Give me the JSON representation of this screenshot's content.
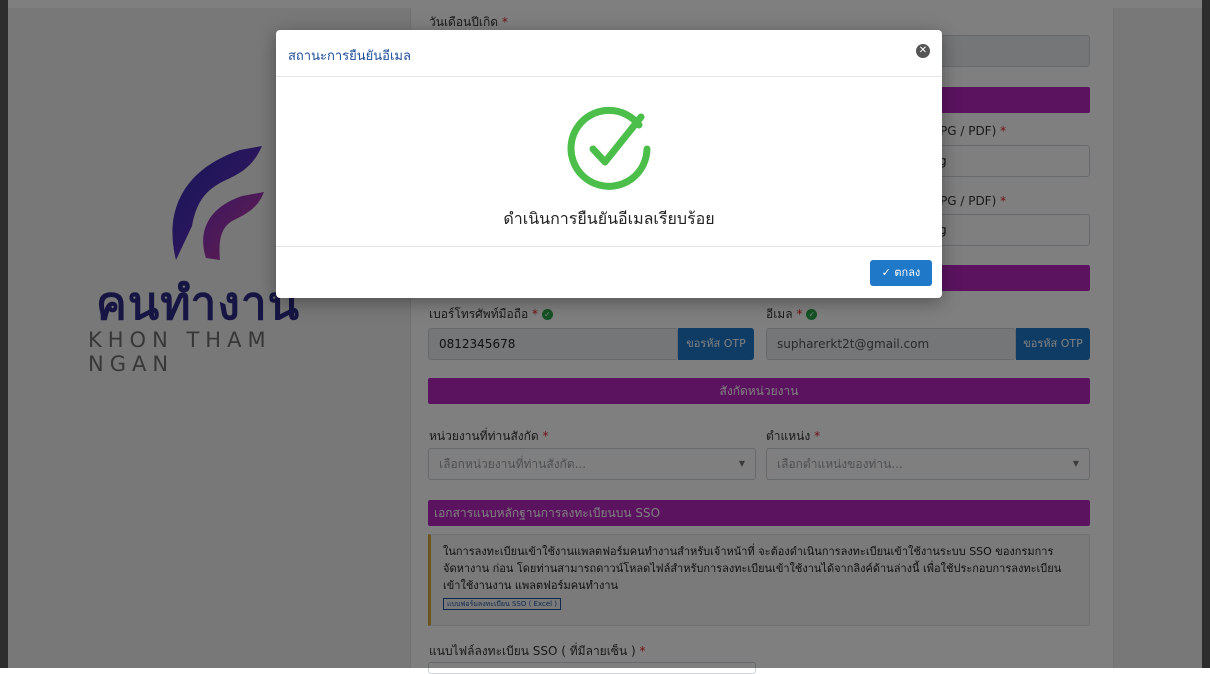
{
  "logo": {
    "thai": "คนทำงาน",
    "english": "KHON THAM NGAN"
  },
  "form": {
    "dob_label": "วันเดือนปีเกิด",
    "required_mark": "*",
    "file1_label": "PG / PDF)",
    "file1_value": "g",
    "file2_label": "PG / PDF)",
    "file2_value": "g",
    "phone_label": "เบอร์โทรศัพท์มือถือ",
    "phone_value": "0812345678",
    "email_label": "อีเมล",
    "email_value": "supharerkt2t@gmail.com",
    "otp_label": "ขอรหัส OTP",
    "section_unit": "สังกัดหน่วยงาน",
    "unit_label": "หน่วยงานที่ท่านสังกัด",
    "unit_placeholder": "เลือกหน่วยงานที่ท่านสังกัด...",
    "position_label": "ตำแหน่ง",
    "position_placeholder": "เลือกตำแหน่งของท่าน...",
    "section_sso": "เอกสารแนบหลักฐานการลงทะเบียนบน SSO",
    "notice_text": "ในการลงทะเบียนเข้าใช้งานแพลตฟอร์มคนทำงานสำหรับเจ้าหน้าที่ จะต้องดำเนินการลงทะเบียนเข้าใช้งานระบบ SSO ของกรมการจัดหางาน ก่อน โดยท่านสามารถดาวน์โหลดไฟล์สำหรับการลงทะเบียนเข้าใช้งานได้จากลิงค์ด้านล่างนี้ เพื่อใช้ประกอบการลงทะเบียนเข้าใช้งานงาน แพลตฟอร์มคนทำงาน",
    "notice_link": "แบบฟอร์มลงทะเบียน SSO ( Excel )",
    "sso_file_label": "แนบไฟล์ลงทะเบียน SSO ( ที่มีลายเซ็น )"
  },
  "modal": {
    "title": "สถานะการยืนยันอีเมล",
    "message": "ดำเนินการยืนยันอีเมลเรียบร้อย",
    "ok_label": "✓ ตกลง",
    "close_glyph": "✕",
    "check_icon": "check-circle-icon",
    "success_color": "#4cbe4a"
  }
}
